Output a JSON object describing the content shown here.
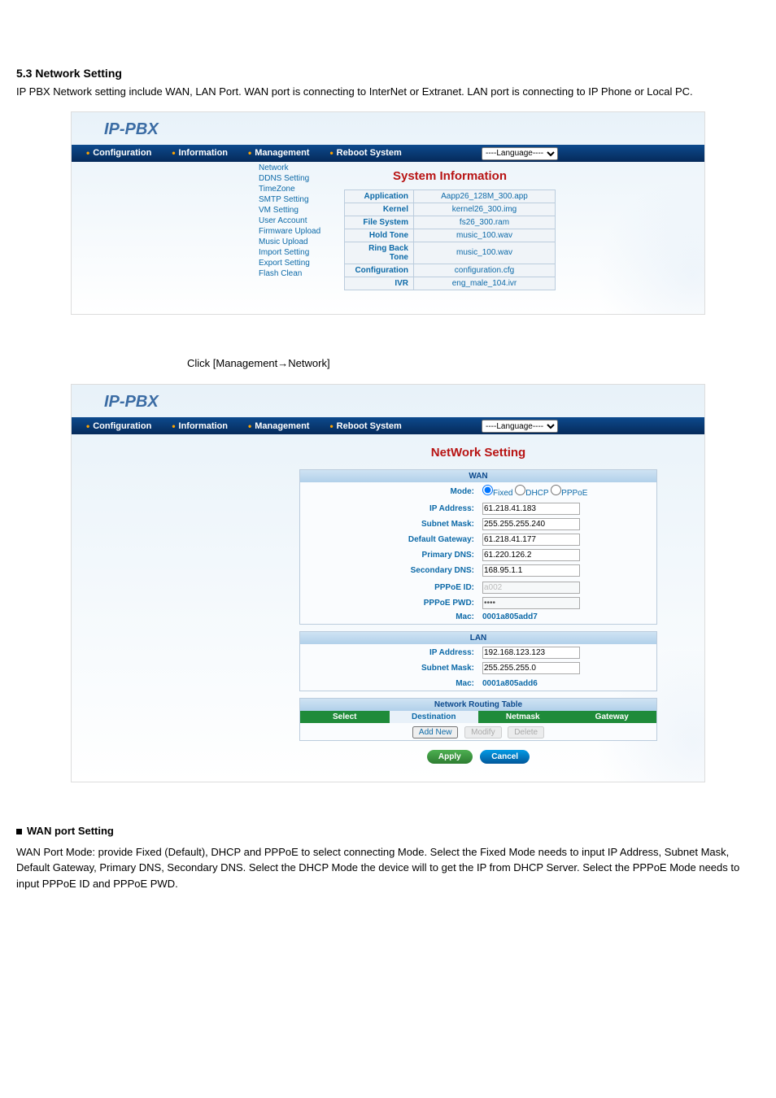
{
  "doc": {
    "section_5_3": {
      "heading": "5.3 Network Setting",
      "body": "IP PBX Network setting include WAN, LAN Port. WAN port is connecting to InterNet or Extranet. LAN port is connecting to IP Phone or Local PC.",
      "path_line": "Click [Management→Network]"
    },
    "wan_heading": "WAN port Setting",
    "wan_mode_body": "WAN Port Mode: provide Fixed (Default), DHCP and PPPoE to select connecting Mode. Select the Fixed Mode needs to input IP Address, Subnet Mask, Default Gateway, Primary DNS, Secondary DNS. Select the DHCP Mode the device will to get the IP from DHCP Server. Select the PPPoE Mode needs to input PPPoE ID and PPPoE PWD."
  },
  "logo": "IP-PBX",
  "nav": {
    "configuration": "Configuration",
    "information": "Information",
    "management": "Management",
    "reboot": "Reboot System",
    "lang_placeholder": "----Language----"
  },
  "sidebar": {
    "items": [
      {
        "label": "Network"
      },
      {
        "label": "DDNS Setting"
      },
      {
        "label": "TimeZone"
      },
      {
        "label": "SMTP Setting"
      },
      {
        "label": "VM Setting"
      },
      {
        "label": "User Account"
      },
      {
        "label": "Firmware Upload"
      },
      {
        "label": "Music Upload"
      },
      {
        "label": "Import Setting"
      },
      {
        "label": "Export Setting"
      },
      {
        "label": "Flash Clean"
      }
    ]
  },
  "sysinfo": {
    "title": "System Information",
    "rows": [
      {
        "k": "Application",
        "v": "Aapp26_128M_300.app"
      },
      {
        "k": "Kernel",
        "v": "kernel26_300.img"
      },
      {
        "k": "File System",
        "v": "fs26_300.ram"
      },
      {
        "k": "Hold Tone",
        "v": "music_100.wav"
      },
      {
        "k": "Ring Back Tone",
        "v": "music_100.wav"
      },
      {
        "k": "Configuration",
        "v": "configuration.cfg"
      },
      {
        "k": "IVR",
        "v": "eng_male_104.ivr"
      }
    ]
  },
  "network": {
    "title": "NetWork Setting",
    "wan": {
      "header": "WAN",
      "mode_label": "Mode:",
      "mode_options": [
        "Fixed",
        "DHCP",
        "PPPoE"
      ],
      "mode_selected": "Fixed",
      "rows": [
        {
          "k": "IP Address:",
          "v": "61.218.41.183"
        },
        {
          "k": "Subnet Mask:",
          "v": "255.255.255.240"
        },
        {
          "k": "Default Gateway:",
          "v": "61.218.41.177"
        },
        {
          "k": "Primary DNS:",
          "v": "61.220.126.2"
        },
        {
          "k": "Secondary DNS:",
          "v": "168.95.1.1"
        }
      ],
      "pppoe_id_label": "PPPoE ID:",
      "pppoe_id_value": "a002",
      "pppoe_pwd_label": "PPPoE PWD:",
      "pppoe_pwd_value": "••••",
      "mac_label": "Mac:",
      "mac_value": "0001a805add7"
    },
    "lan": {
      "header": "LAN",
      "rows": [
        {
          "k": "IP Address:",
          "v": "192.168.123.123"
        },
        {
          "k": "Subnet Mask:",
          "v": "255.255.255.0"
        }
      ],
      "mac_label": "Mac:",
      "mac_value": "0001a805add6"
    },
    "nrt": {
      "header": "Network Routing Table",
      "cols": [
        "Select",
        "Destination",
        "Netmask",
        "Gateway"
      ],
      "buttons": {
        "add": "Add New",
        "modify": "Modify",
        "delete": "Delete"
      }
    },
    "actions": {
      "apply": "Apply",
      "cancel": "Cancel"
    }
  }
}
